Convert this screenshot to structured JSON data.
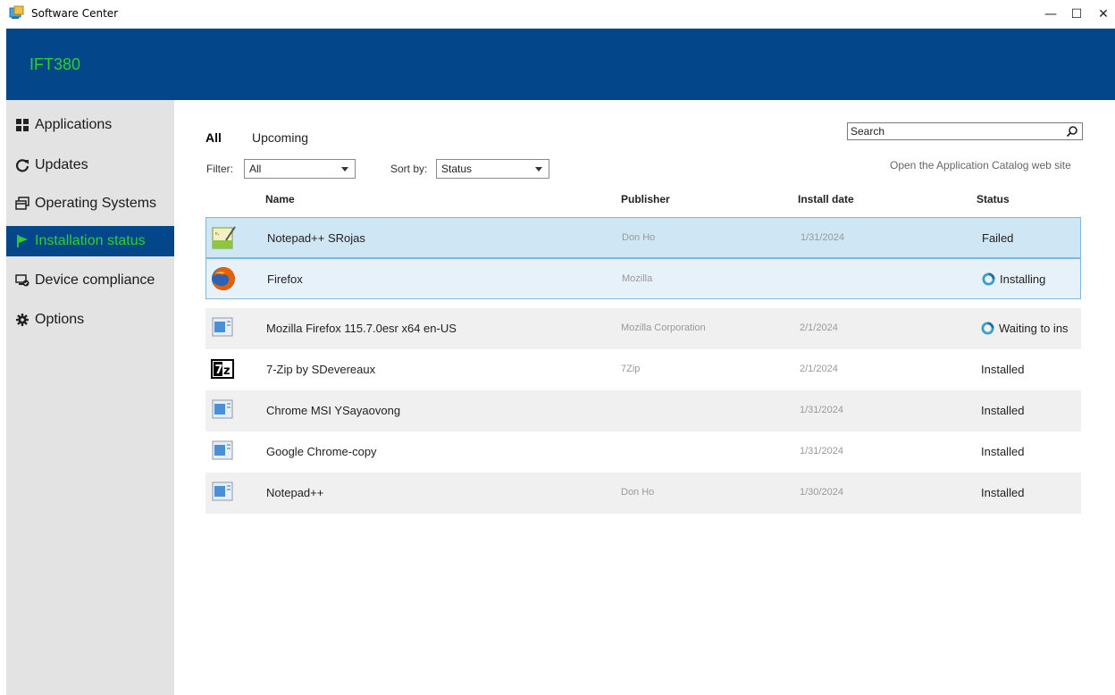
{
  "window": {
    "title": "Software Center",
    "controls": {
      "minimize": "—",
      "maximize": "☐",
      "close": "✕"
    }
  },
  "header": {
    "org_name": "IFT380",
    "brand_color": "#03478a",
    "accent_color": "#2ad32a"
  },
  "sidebar": {
    "items": [
      {
        "label": "Applications",
        "icon": "applications-grid-icon",
        "active": false
      },
      {
        "label": "Updates",
        "icon": "refresh-icon",
        "active": false
      },
      {
        "label": "Operating Systems",
        "icon": "windows-stack-icon",
        "active": false
      },
      {
        "label": "Installation status",
        "icon": "flag-icon",
        "active": true
      },
      {
        "label": "Device compliance",
        "icon": "compliance-icon",
        "active": false
      },
      {
        "label": "Options",
        "icon": "gear-icon",
        "active": false
      }
    ]
  },
  "tabs": {
    "all": "All",
    "upcoming": "Upcoming"
  },
  "search": {
    "value": "Search"
  },
  "filter": {
    "label": "Filter:",
    "value": "All"
  },
  "sort": {
    "label": "Sort by:",
    "value": "Status"
  },
  "catalog_link": "Open the Application Catalog web site",
  "columns": {
    "name": "Name",
    "publisher": "Publisher",
    "install_date": "Install date",
    "status": "Status"
  },
  "rows": [
    {
      "name": "Notepad++ SRojas",
      "publisher": "Don Ho",
      "date": "1/31/2024",
      "status": "Failed",
      "icon": "notepadpp-icon",
      "status_icon": ""
    },
    {
      "name": "Firefox",
      "publisher": "Mozilla",
      "date": "",
      "status": "Installing",
      "icon": "firefox-icon",
      "status_icon": "progress-ring-icon"
    },
    {
      "name": "Mozilla Firefox 115.7.0esr x64 en-US",
      "publisher": "Mozilla Corporation",
      "date": "2/1/2024",
      "status": "Waiting to ins",
      "icon": "generic-app-icon",
      "status_icon": "progress-ring-icon"
    },
    {
      "name": "7-Zip by SDevereaux",
      "publisher": "7Zip",
      "date": "2/1/2024",
      "status": "Installed",
      "icon": "7zip-icon",
      "status_icon": ""
    },
    {
      "name": "Chrome MSI YSayaovong",
      "publisher": "",
      "date": "1/31/2024",
      "status": "Installed",
      "icon": "generic-app-icon",
      "status_icon": ""
    },
    {
      "name": "Google Chrome-copy",
      "publisher": "",
      "date": "1/31/2024",
      "status": "Installed",
      "icon": "generic-app-icon",
      "status_icon": ""
    },
    {
      "name": "Notepad++",
      "publisher": "Don Ho",
      "date": "1/30/2024",
      "status": "Installed",
      "icon": "generic-app-icon",
      "status_icon": ""
    }
  ]
}
